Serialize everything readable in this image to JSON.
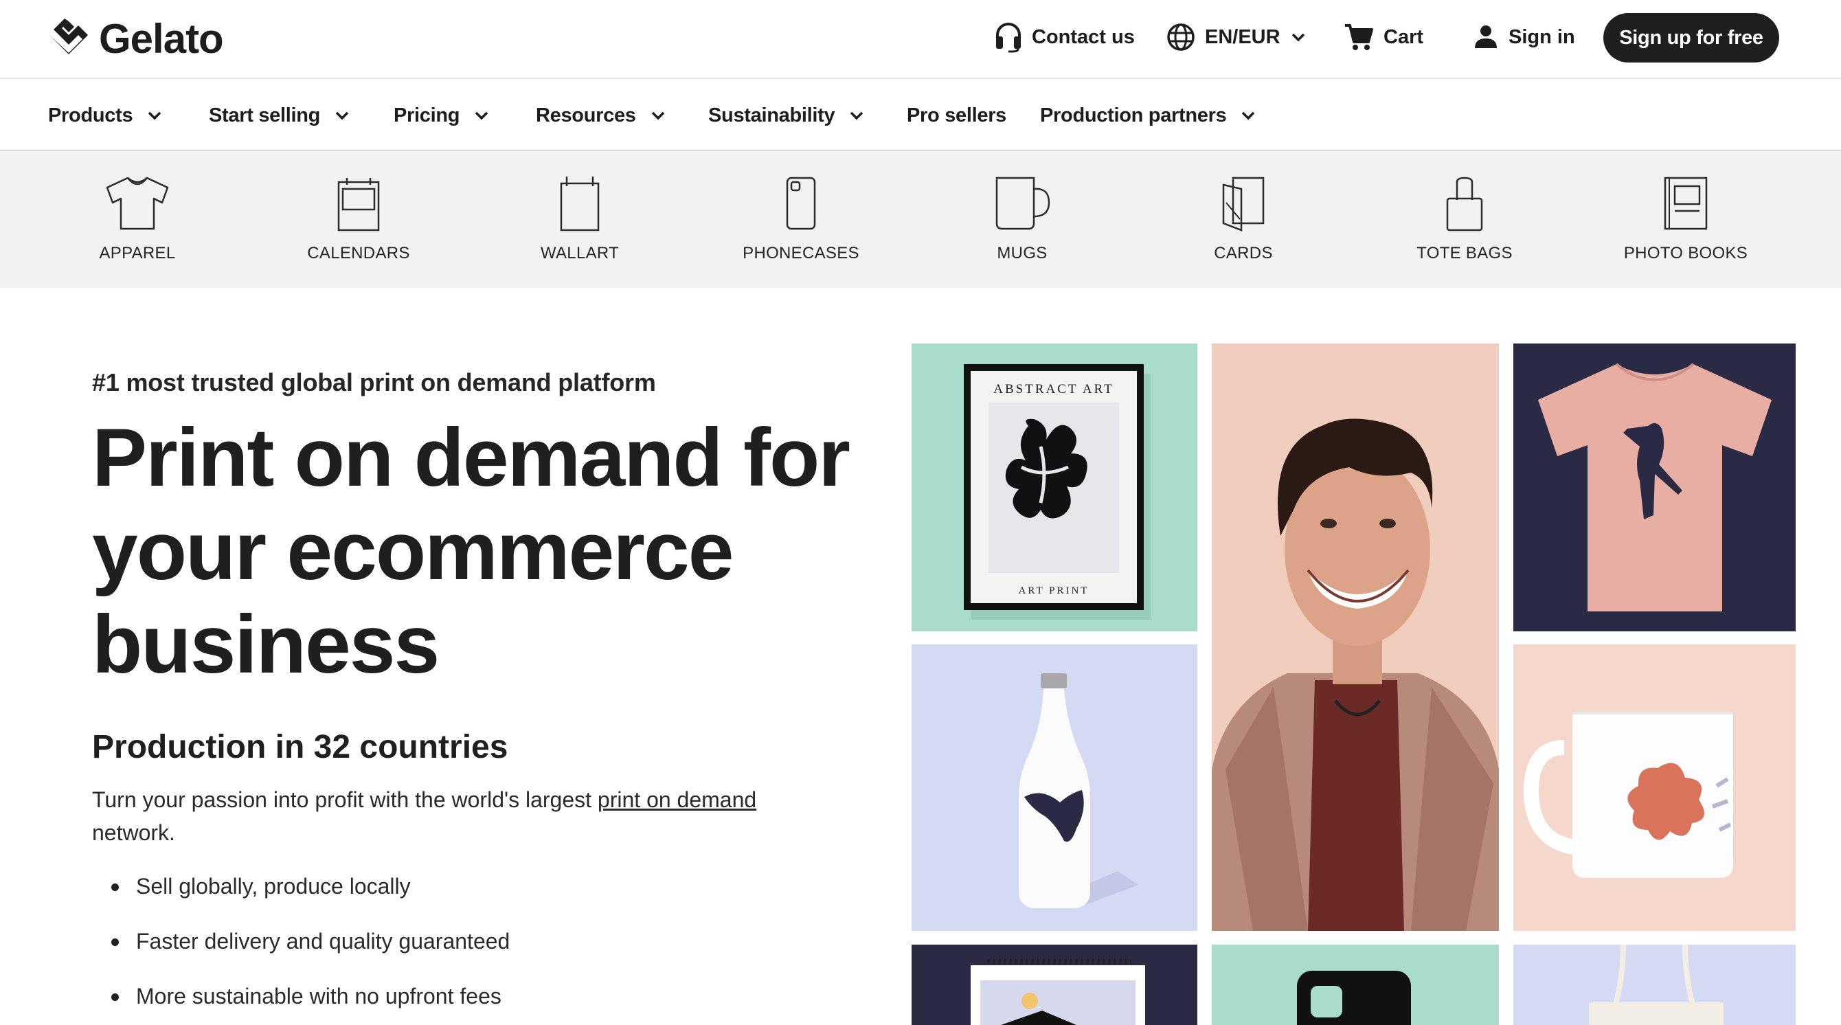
{
  "brand": {
    "name": "Gelato",
    "logo_icon": "gelato-mark-icon"
  },
  "utility": {
    "contact": "Contact us",
    "locale": "EN/EUR",
    "cart": "Cart",
    "signin": "Sign in",
    "signup": "Sign up for free"
  },
  "nav": {
    "products": "Products",
    "start_selling": "Start selling",
    "pricing": "Pricing",
    "resources": "Resources",
    "sustainability": "Sustainability",
    "pro_sellers": "Pro sellers",
    "production_partners": "Production partners"
  },
  "categories": {
    "apparel": "APPAREL",
    "calendars": "CALENDARS",
    "wallart": "WALLART",
    "phonecases": "PHONECASES",
    "mugs": "MUGS",
    "cards": "CARDS",
    "tote_bags": "TOTE BAGS",
    "photo_books": "PHOTO BOOKS"
  },
  "hero": {
    "eyebrow": "#1 most trusted global print on demand platform",
    "headline": "Print on demand for your ecommerce business",
    "subhead": "Production in 32 countries",
    "para_before": "Turn your passion into profit with the world's largest ",
    "para_link": "print on demand",
    "para_after": " network.",
    "bullets": [
      "Sell globally, produce locally",
      "Faster delivery and quality guaranteed",
      "More sustainable with no upfront fees"
    ]
  },
  "gallery": {
    "poster_title": "ABSTRACT ART",
    "poster_caption": "ART PRINT"
  },
  "colors": {
    "mint": "#a9dccd",
    "peach": "#f1cdbd",
    "navy": "#2a2a44",
    "lavender": "#d5daf4",
    "blush": "#f6d7cc",
    "dark": "#1f1f1f"
  }
}
